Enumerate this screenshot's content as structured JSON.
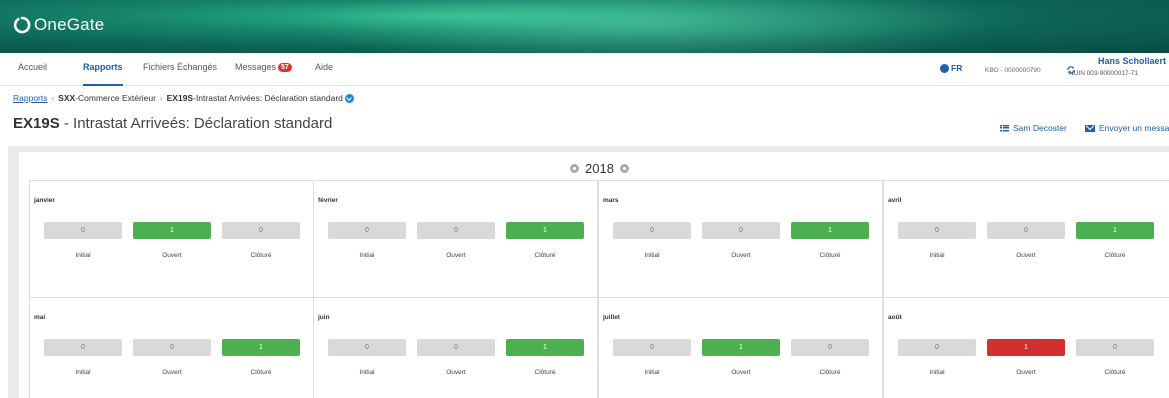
{
  "app": {
    "logo_text": "OneGate"
  },
  "nav": {
    "items": [
      {
        "label": "Accueil",
        "active": false
      },
      {
        "label": "Rapports",
        "active": true
      },
      {
        "label": "Fichiers Échangés",
        "active": false
      },
      {
        "label": "Messages",
        "badge": "57",
        "active": false
      },
      {
        "label": "Aide",
        "active": false
      }
    ],
    "language": "FR",
    "kbo": "KBO - 0000000790",
    "user_name": "Hans Schollaert",
    "user_nuin": "NUIN 003-90000017-71"
  },
  "breadcrumb": {
    "root": "Rapports",
    "level1_code": "SXX",
    "level1_label": " -Commerce Extérieur",
    "level2_code": "EX19S",
    "level2_label": " -Intrastat Arrivées: Déclaration standard"
  },
  "page": {
    "title_code": "EX19S",
    "title_rest": " - Intrastat Arriveés: Déclaration standard",
    "action_person": "Sam Decoster",
    "action_send": "Envoyer un messa"
  },
  "calendar": {
    "year": "2018",
    "status_labels": [
      "Initial",
      "Ouvert",
      "Clôturé"
    ],
    "months": [
      {
        "name": "janvier",
        "counts": [
          "0",
          "1",
          "0"
        ],
        "colors": [
          "grey",
          "green",
          "grey"
        ]
      },
      {
        "name": "février",
        "counts": [
          "0",
          "0",
          "1"
        ],
        "colors": [
          "grey",
          "grey",
          "green"
        ]
      },
      {
        "name": "mars",
        "counts": [
          "0",
          "0",
          "1"
        ],
        "colors": [
          "grey",
          "grey",
          "green"
        ]
      },
      {
        "name": "avril",
        "counts": [
          "0",
          "0",
          "1"
        ],
        "colors": [
          "grey",
          "grey",
          "green"
        ]
      },
      {
        "name": "mai",
        "counts": [
          "0",
          "0",
          "1"
        ],
        "colors": [
          "grey",
          "grey",
          "green"
        ]
      },
      {
        "name": "juin",
        "counts": [
          "0",
          "0",
          "1"
        ],
        "colors": [
          "grey",
          "grey",
          "green"
        ]
      },
      {
        "name": "juillet",
        "counts": [
          "0",
          "1",
          "0"
        ],
        "colors": [
          "grey",
          "green",
          "grey"
        ]
      },
      {
        "name": "août",
        "counts": [
          "0",
          "1",
          "0"
        ],
        "colors": [
          "grey",
          "red",
          "grey"
        ]
      }
    ]
  },
  "colors": {
    "primary": "#1e5fae",
    "open_green": "#4caf50",
    "alert_red": "#d32f2f",
    "neutral_grey": "#d9d9d9",
    "banner_teal": "#17876d"
  }
}
